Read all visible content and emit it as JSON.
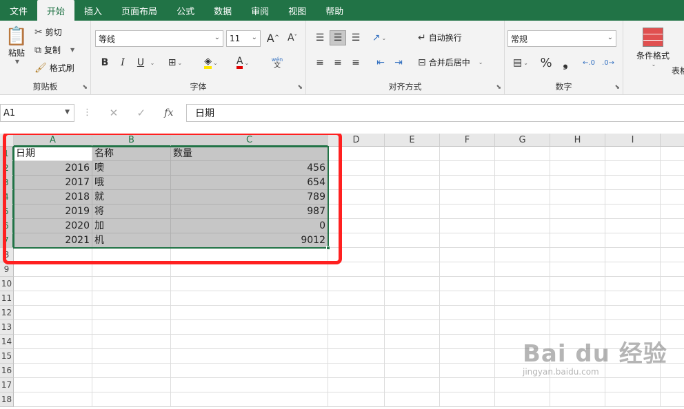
{
  "tabs": [
    "文件",
    "开始",
    "插入",
    "页面布局",
    "公式",
    "数据",
    "审阅",
    "视图",
    "帮助"
  ],
  "active_tab": "开始",
  "clipboard": {
    "paste": "粘贴",
    "cut": "剪切",
    "copy": "复制",
    "format_painter": "格式刷",
    "label": "剪贴板"
  },
  "font": {
    "name": "等线",
    "size": "11",
    "bold": "B",
    "italic": "I",
    "underline": "U",
    "label": "字体",
    "increase": "A",
    "decrease": "A",
    "phonetic": "wén"
  },
  "alignment": {
    "wrap": "自动换行",
    "merge": "合并后居中",
    "label": "对齐方式"
  },
  "number": {
    "format": "常规",
    "percent": "%",
    "comma": "❟",
    "label": "数字"
  },
  "styles": {
    "conditional": "条件格式",
    "table_partial": "表格"
  },
  "formula_bar": {
    "name_box": "A1",
    "content": "日期",
    "fx": "fx"
  },
  "columns": [
    "A",
    "B",
    "C",
    "D",
    "E",
    "F",
    "G",
    "H",
    "I"
  ],
  "rows": [
    "1",
    "2",
    "3",
    "4",
    "5",
    "6",
    "7",
    "8",
    "9",
    "10",
    "11",
    "12",
    "13",
    "14",
    "15",
    "16",
    "17",
    "18"
  ],
  "table": {
    "headers": [
      "日期",
      "名称",
      "数量"
    ],
    "data": [
      [
        "2016",
        "噢",
        "456"
      ],
      [
        "2017",
        "哦",
        "654"
      ],
      [
        "2018",
        "就",
        "789"
      ],
      [
        "2019",
        "将",
        "987"
      ],
      [
        "2020",
        "加",
        "0"
      ],
      [
        "2021",
        "机",
        "9012"
      ]
    ]
  },
  "watermark": {
    "brand": "Bai du 经验",
    "url": "jingyan.baidu.com"
  },
  "colors": {
    "excel_green": "#217346",
    "highlight_red": "#ff2020",
    "selection_gray": "#c6c6c6"
  }
}
